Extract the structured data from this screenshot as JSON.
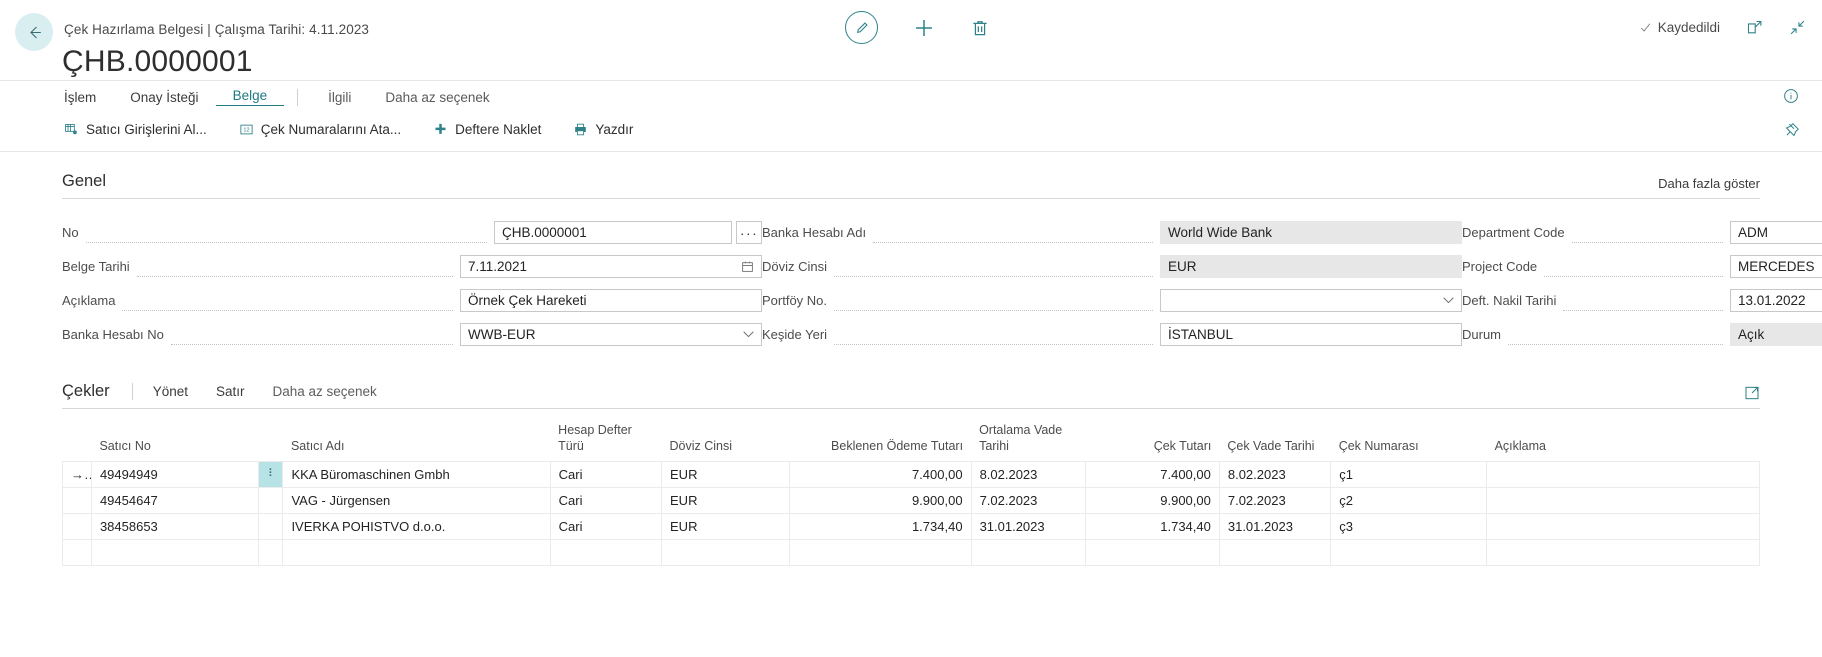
{
  "topbar": {
    "back_icon": "arrow-left-icon",
    "breadcrumb": "Çek Hazırlama Belgesi | Çalışma Tarihi: 4.11.2023",
    "title": "ÇHB.0000001",
    "edit_icon": "pencil-icon",
    "new_icon": "plus-icon",
    "delete_icon": "trash-icon",
    "saved_label": "Kaydedildi",
    "saved_icon": "check-icon",
    "open_new_window_icon": "open-in-new-window-icon",
    "collapse_icon": "collapse-arrows-icon"
  },
  "nav": {
    "tabs": [
      {
        "label": "İşlem",
        "active": false
      },
      {
        "label": "Onay İsteği",
        "active": false
      },
      {
        "label": "Belge",
        "active": true
      }
    ],
    "tabs_after": [
      {
        "label": "İlgili",
        "active": false
      },
      {
        "label": "Daha az seçenek",
        "active": false
      }
    ],
    "info_icon": "info-circle-icon"
  },
  "ribbon": {
    "items": [
      {
        "label": "Satıcı Girişlerini Al...",
        "icon": "get-vendor-entries-icon"
      },
      {
        "label": "Çek Numaralarını Ata...",
        "icon": "assign-check-numbers-icon"
      },
      {
        "label": "Deftere Naklet",
        "icon": "post-icon"
      },
      {
        "label": "Yazdır",
        "icon": "printer-icon"
      }
    ],
    "pin_icon": "pin-icon"
  },
  "general": {
    "title": "Genel",
    "show_more": "Daha fazla göster",
    "col1": [
      {
        "label": "No",
        "value": "ÇHB.0000001",
        "type": "text-with-lookup",
        "readonly": false
      },
      {
        "label": "Belge Tarihi",
        "value": "7.11.2021",
        "type": "date",
        "readonly": false
      },
      {
        "label": "Açıklama",
        "value": "Örnek Çek Hareketi",
        "type": "text",
        "readonly": false
      },
      {
        "label": "Banka Hesabı No",
        "value": "WWB-EUR",
        "type": "select",
        "readonly": false
      }
    ],
    "col2": [
      {
        "label": "Banka Hesabı Adı",
        "value": "World Wide Bank",
        "type": "text",
        "readonly": true
      },
      {
        "label": "Döviz Cinsi",
        "value": "EUR",
        "type": "text",
        "readonly": true
      },
      {
        "label": "Portföy No.",
        "value": "",
        "type": "select",
        "readonly": false
      },
      {
        "label": "Keşide Yeri",
        "value": "İSTANBUL",
        "type": "text",
        "readonly": false
      }
    ],
    "col3": [
      {
        "label": "Department Code",
        "value": "ADM",
        "type": "select",
        "readonly": false
      },
      {
        "label": "Project Code",
        "value": "MERCEDES",
        "type": "select",
        "readonly": false
      },
      {
        "label": "Deft. Nakil Tarihi",
        "value": "13.01.2022",
        "type": "date",
        "readonly": false
      },
      {
        "label": "Durum",
        "value": "Açık",
        "type": "text",
        "readonly": true
      }
    ]
  },
  "checks": {
    "title": "Çekler",
    "subtabs": [
      {
        "label": "Yönet"
      },
      {
        "label": "Satır"
      },
      {
        "label": "Daha az seçenek"
      }
    ],
    "expand_icon": "expand-grid-icon",
    "columns": [
      {
        "label": "Satıcı No",
        "align": "left"
      },
      {
        "label": "Satıcı Adı",
        "align": "left"
      },
      {
        "label": "Hesap Defter Türü",
        "align": "left"
      },
      {
        "label": "Döviz Cinsi",
        "align": "left"
      },
      {
        "label": "Beklenen Ödeme Tutarı",
        "align": "right"
      },
      {
        "label": "Ortalama Vade Tarihi",
        "align": "left"
      },
      {
        "label": "Çek Tutarı",
        "align": "right"
      },
      {
        "label": "Çek Vade Tarihi",
        "align": "left"
      },
      {
        "label": "Çek Numarası",
        "align": "left"
      },
      {
        "label": "Açıklama",
        "align": "left"
      }
    ],
    "rows": [
      {
        "selected": true,
        "arrow": "→",
        "satici_no": "49494949",
        "satici_adi": "KKA Büromaschinen Gmbh",
        "hesap_defter_turu": "Cari",
        "doviz_cinsi": "EUR",
        "beklenen_odeme": "7.400,00",
        "ortalama_vade": "8.02.2023",
        "cek_tutari": "7.400,00",
        "cek_vade": "8.02.2023",
        "cek_numarasi": "ç1",
        "aciklama": ""
      },
      {
        "selected": false,
        "arrow": "",
        "satici_no": "49454647",
        "satici_adi": "VAG - Jürgensen",
        "hesap_defter_turu": "Cari",
        "doviz_cinsi": "EUR",
        "beklenen_odeme": "9.900,00",
        "ortalama_vade": "7.02.2023",
        "cek_tutari": "9.900,00",
        "cek_vade": "7.02.2023",
        "cek_numarasi": "ç2",
        "aciklama": ""
      },
      {
        "selected": false,
        "arrow": "",
        "satici_no": "38458653",
        "satici_adi": "IVERKA POHISTVO d.o.o.",
        "hesap_defter_turu": "Cari",
        "doviz_cinsi": "EUR",
        "beklenen_odeme": "1.734,40",
        "ortalama_vade": "31.01.2023",
        "cek_tutari": "1.734,40",
        "cek_vade": "31.01.2023",
        "cek_numarasi": "ç3",
        "aciklama": ""
      },
      {
        "selected": false,
        "arrow": "",
        "satici_no": "",
        "satici_adi": "",
        "hesap_defter_turu": "",
        "doviz_cinsi": "",
        "beklenen_odeme": "",
        "ortalama_vade": "",
        "cek_tutari": "",
        "cek_vade": "",
        "cek_numarasi": "",
        "aciklama": ""
      }
    ]
  },
  "colors": {
    "accent": "#2e8289",
    "link": "#1f7a82",
    "selection": "#b8e3e6",
    "readonly_bg": "#e7e7e7"
  }
}
